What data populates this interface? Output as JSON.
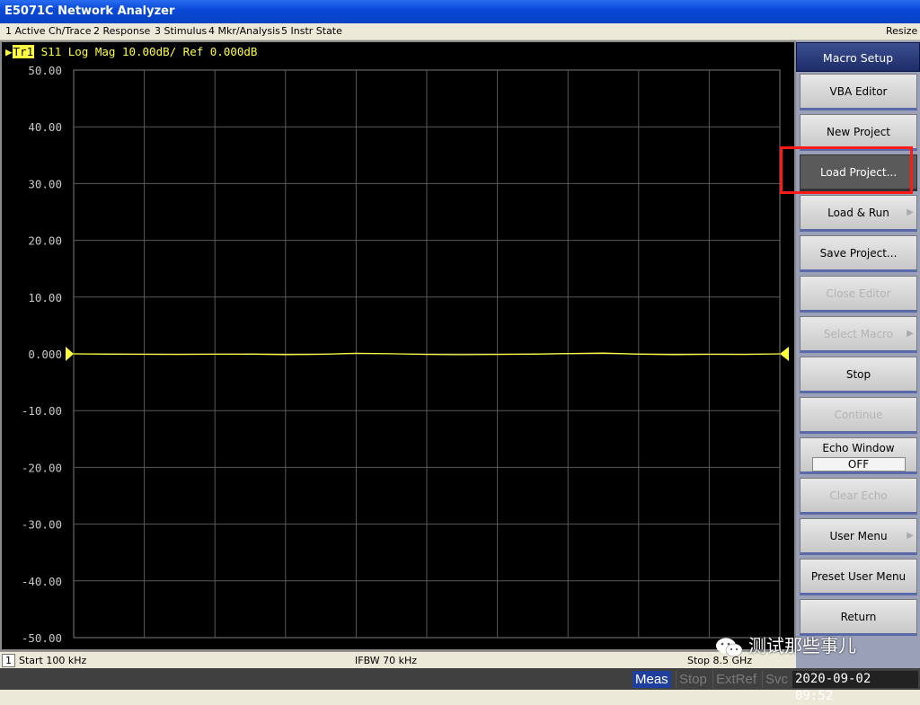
{
  "window": {
    "title": "E5071C Network Analyzer"
  },
  "menu": {
    "items": [
      "1 Active Ch/Trace",
      "2 Response",
      "3 Stimulus",
      "4 Mkr/Analysis",
      "5 Instr State"
    ],
    "resize": "Resize"
  },
  "trace": {
    "tag": "Tr1",
    "label": "S11 Log Mag 10.00dB/ Ref 0.000dB"
  },
  "status": {
    "channel": "1",
    "start": "Start 100 kHz",
    "ifbw": "IFBW 70 kHz",
    "stop": "Stop 8.5 GHz"
  },
  "bottom": {
    "meas": "Meas",
    "stop": "Stop",
    "extref": "ExtRef",
    "svc": "Svc",
    "datetime": "2020-09-02 09:52"
  },
  "softkeys": {
    "title": "Macro Setup",
    "buttons": [
      {
        "label": "VBA Editor",
        "state": "normal"
      },
      {
        "label": "New Project",
        "state": "normal"
      },
      {
        "label": "Load Project...",
        "state": "selected"
      },
      {
        "label": "Load & Run",
        "state": "normal",
        "submenu": true
      },
      {
        "label": "Save Project...",
        "state": "normal"
      },
      {
        "label": "Close Editor",
        "state": "disabled"
      },
      {
        "label": "Select Macro",
        "state": "disabled",
        "submenu": true
      },
      {
        "label": "Stop",
        "state": "normal"
      },
      {
        "label": "Continue",
        "state": "disabled"
      },
      {
        "label": "Echo Window",
        "state": "normal",
        "value": "OFF"
      },
      {
        "label": "Clear Echo",
        "state": "disabled"
      },
      {
        "label": "User Menu",
        "state": "normal",
        "submenu": true
      },
      {
        "label": "Preset User Menu",
        "state": "normal"
      },
      {
        "label": "Return",
        "state": "normal"
      }
    ]
  },
  "watermark": {
    "text": "测试那些事儿"
  },
  "colors": {
    "trace": "#ffff40",
    "grid": "#5a5a5a",
    "axis_text": "#c8c8c8",
    "highlight": "#ff1a1a"
  },
  "chart_data": {
    "type": "line",
    "title": "S11 Log Mag 10.00dB/ Ref 0.000dB",
    "xlabel": "",
    "ylabel": "",
    "x_start": "Start 100 kHz",
    "x_stop": "Stop 8.5 GHz",
    "ylim": [
      -50,
      50
    ],
    "yticks": [
      "50.00",
      "40.00",
      "30.00",
      "20.00",
      "10.00",
      "0.000",
      "-10.00",
      "-20.00",
      "-30.00",
      "-40.00",
      "-50.00"
    ],
    "ref_value": 0,
    "grid": true,
    "x_divisions": 10,
    "series": [
      {
        "name": "S11",
        "values": [
          0.0,
          -0.05,
          -0.08,
          -0.1,
          -0.07,
          -0.05,
          -0.12,
          -0.08,
          0.1,
          0.02,
          -0.1,
          -0.15,
          -0.1,
          -0.05,
          0.05,
          0.12,
          -0.05,
          -0.12,
          -0.08,
          -0.1,
          0.0
        ]
      }
    ]
  }
}
